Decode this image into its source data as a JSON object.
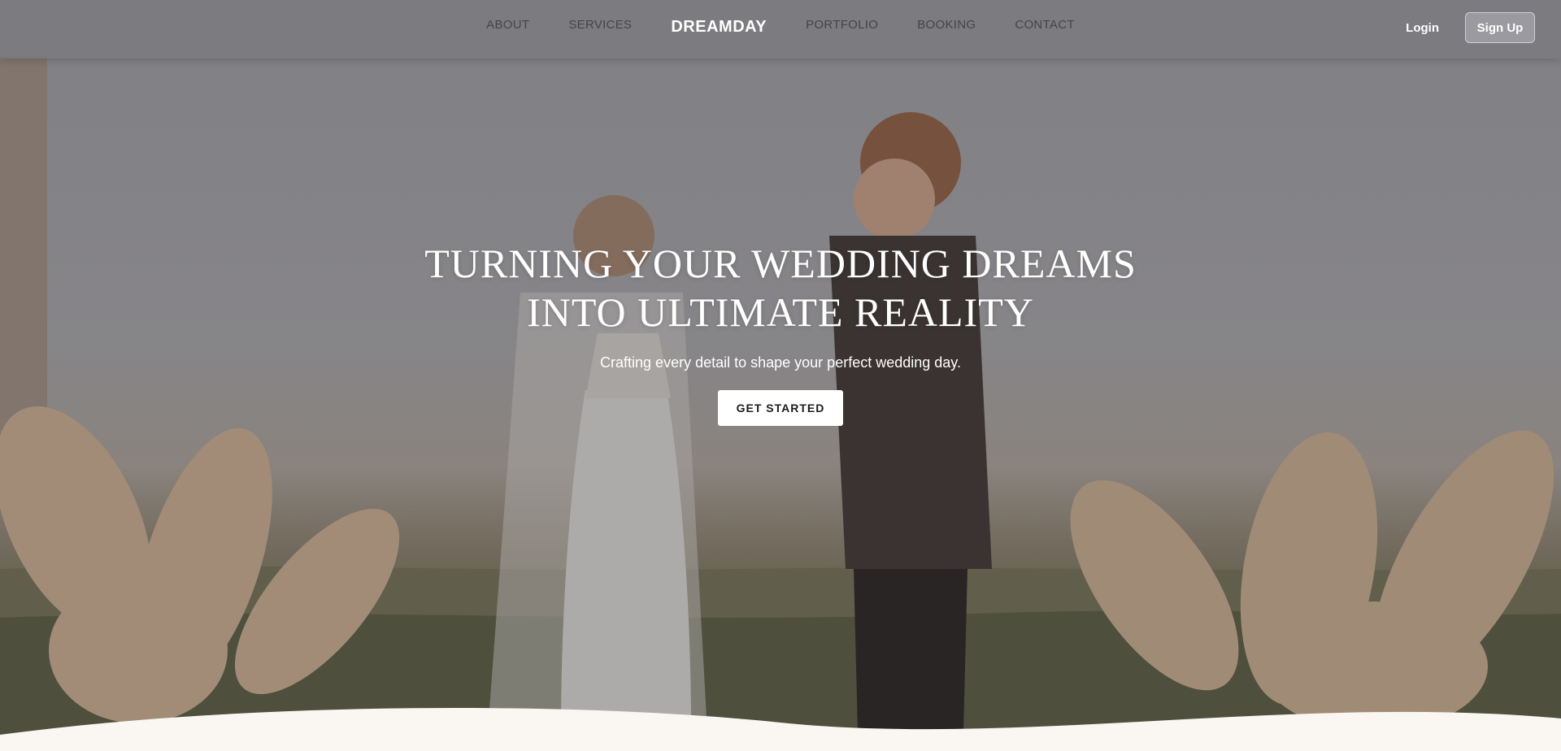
{
  "nav": {
    "brand": "DREAMDAY",
    "left_links": [
      "ABOUT",
      "SERVICES"
    ],
    "right_links": [
      "PORTFOLIO",
      "BOOKING",
      "CONTACT"
    ],
    "login_label": "Login",
    "signup_label": "Sign Up"
  },
  "hero": {
    "title_line1": "TURNING YOUR WEDDING DREAMS",
    "title_line2": "INTO ULTIMATE REALITY",
    "subtitle": "Crafting every detail to shape your perfect wedding day.",
    "cta_label": "GET STARTED",
    "image_subject": "wedding-couple-photo"
  },
  "colors": {
    "nav_background": "#78787e",
    "nav_link": "#454549",
    "brand": "#ffffff",
    "cta_background": "#ffffff",
    "cta_text": "#1c1c1c",
    "page_background": "#faf6f1"
  }
}
